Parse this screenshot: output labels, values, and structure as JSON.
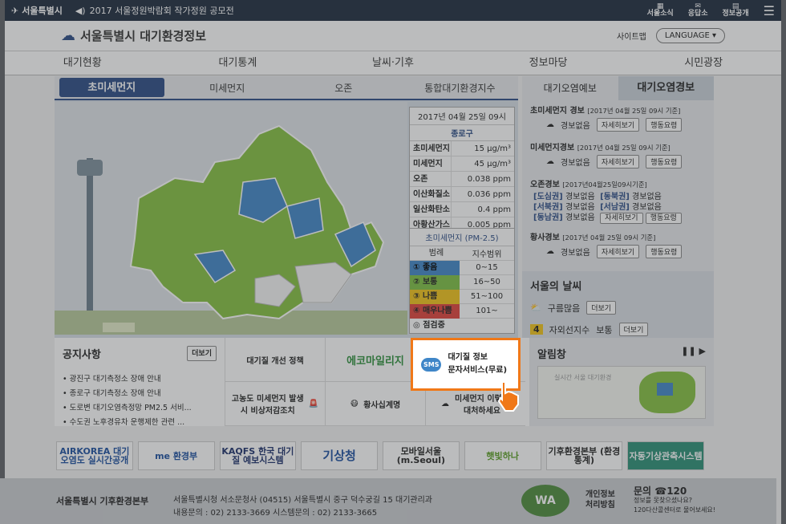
{
  "topbar": {
    "logo": "서울특별시",
    "notice": "2017 서울정원박람회 작가정원 공모전",
    "tools": [
      "서울소식",
      "응답소",
      "정보공개"
    ]
  },
  "header": {
    "brand": "서울특별시 대기환경정보",
    "sitemap": "사이트맵",
    "lang": "LANGUAGE"
  },
  "gnb": [
    "대기현황",
    "대기통계",
    "날씨·기후",
    "정보마당",
    "시민광장"
  ],
  "subtabs": [
    "초미세먼지",
    "미세먼지",
    "오존",
    "통합대기환경지수"
  ],
  "info": {
    "date": "2017년 04월 25일 09시",
    "district": "종로구",
    "rows": [
      [
        "초미세먼지",
        "15 μg/m³"
      ],
      [
        "미세먼지",
        "45 μg/m³"
      ],
      [
        "오존",
        "0.038 ppm"
      ],
      [
        "이산화질소",
        "0.036 ppm"
      ],
      [
        "일산화탄소",
        "0.4 ppm"
      ],
      [
        "아황산가스",
        "0.005 ppm"
      ]
    ]
  },
  "legend": {
    "title": "초미세먼지 (PM-2.5)",
    "head": [
      "범례",
      "지수범위"
    ],
    "rows": [
      {
        "label": "① 좋음",
        "range": "0~15",
        "color": "#3f86c8"
      },
      {
        "label": "② 보통",
        "range": "16~50",
        "color": "#7dc142"
      },
      {
        "label": "③ 나쁨",
        "range": "51~100",
        "color": "#f2c418"
      },
      {
        "label": "④ 매우나쁨",
        "range": "101~",
        "color": "#e0413a"
      },
      {
        "label": "◎ 점검중",
        "range": "",
        "color": "#ffffff"
      }
    ]
  },
  "alert": {
    "tabs": [
      "대기오염예보",
      "대기오염경보"
    ],
    "pm25": {
      "title": "초미세먼지 경보",
      "date": "[2017년 04월 25일 09시 기준]",
      "status": "경보없음"
    },
    "pm10": {
      "title": "미세먼지경보",
      "date": "[2017년 04월 25일 09시 기준]",
      "status": "경보없음"
    },
    "ozone": {
      "title": "오존경보",
      "date": "[2017년04월25일09시기준]",
      "regions": [
        [
          "[도심권]",
          "경보없음",
          "[동북권]",
          "경보없음"
        ],
        [
          "[서북권]",
          "경보없음",
          "[서남권]",
          "경보없음"
        ],
        [
          "[동남권]",
          "경보없음",
          "",
          ""
        ]
      ]
    },
    "dust": {
      "title": "황사경보",
      "date": "[2017년 04월 25일 09시 기준]",
      "status": "경보없음"
    },
    "btn_detail": "자세히보기",
    "btn_action": "행동요령"
  },
  "weather": {
    "title": "서울의 날씨",
    "condition": "구름많음",
    "uv_label": "자외선지수",
    "uv_level": "4",
    "uv_value": "보통",
    "more": "더보기"
  },
  "notice": {
    "title": "공지사항",
    "more": "더보기",
    "items": [
      "광진구 대기측정소 장애 안내",
      "종로구 대기측정소 장애 안내",
      "도로변 대기오염측정망 PM2.5 서비...",
      "수도권 노후경유차 운행제한 관련 ..."
    ]
  },
  "cells": [
    "대기질 개선 정책",
    "에코마일리지",
    "",
    "고농도 미세먼지 발생시 비상저감조치",
    "황사십계명",
    "미세먼지 이렇게 대처하세요"
  ],
  "sms": {
    "icon": "SMS",
    "line1": "대기질 정보",
    "line2": "문자서비스(무료)"
  },
  "alarm": {
    "title": "알림창",
    "map_caption": "실시간 서울 대기환경"
  },
  "banners": [
    "AIRKOREA 대기오염도 실시간공개",
    "me 환경부",
    "KAQFS 한국 대기질 예보시스템",
    "기상청",
    "모바일서울 (m.Seoul)",
    "햇빛하나",
    "기후환경본부 (환경통계)",
    "자동기상관측시스템"
  ],
  "footer": {
    "org": "서울특별시 기후환경본부",
    "addr1": "서울특별시청 서소문청사 (04515) 서울특별시 중구 덕수궁길 15 대기관리과",
    "addr2": "내용문의 : 02) 2133-3669 시스템문의 : 02) 2133-3665",
    "priv1": "개인정보",
    "priv2": "처리방침",
    "call_title": "문의 ☎120",
    "call1": "정보를 못찾으셨나요?",
    "call2": "120다산콜센터로 물어보세요!"
  }
}
